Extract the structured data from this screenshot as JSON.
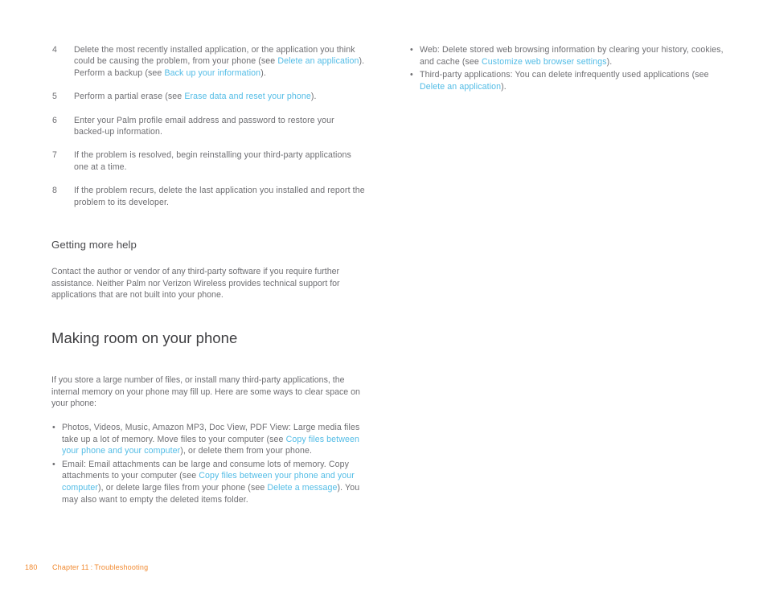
{
  "document": {
    "page_number": "180",
    "chapter_label": "Chapter 11",
    "chapter_separator": ":",
    "chapter_title": "Troubleshooting"
  },
  "colors": {
    "link": "#52bce6",
    "body_text": "#6e6e72",
    "heading": "#3f3f42",
    "footer": "#f1892f",
    "background": "#ffffff"
  },
  "left_column": {
    "steps": [
      {
        "number": "4",
        "parts": [
          {
            "type": "text",
            "text": "Delete the most recently installed application, or the application you think could be causing the problem, from your phone (see "
          },
          {
            "type": "link",
            "text": "Delete an application"
          },
          {
            "type": "text",
            "text": "). Perform a backup (see "
          },
          {
            "type": "link",
            "text": "Back up your information"
          },
          {
            "type": "text",
            "text": ")."
          }
        ]
      },
      {
        "number": "5",
        "parts": [
          {
            "type": "text",
            "text": "Perform a partial erase (see "
          },
          {
            "type": "link",
            "text": "Erase data and reset your phone"
          },
          {
            "type": "text",
            "text": ")."
          }
        ]
      },
      {
        "number": "6",
        "parts": [
          {
            "type": "text",
            "text": "Enter your Palm profile email address and password to restore your backed-up information."
          }
        ]
      },
      {
        "number": "7",
        "parts": [
          {
            "type": "text",
            "text": "If the problem is resolved, begin reinstalling your third-party applications one at a time."
          }
        ]
      },
      {
        "number": "8",
        "parts": [
          {
            "type": "text",
            "text": "If the problem recurs, delete the last application you installed and report the problem to its developer."
          }
        ]
      }
    ],
    "getting_more_help_heading": "Getting more help",
    "getting_more_help_paragraph": "Contact the author or vendor of any third-party software if you require further assistance. Neither Palm nor Verizon Wireless provides technical support for applications that are not built into your phone.",
    "making_room_heading": "Making room on your phone",
    "making_room_paragraph": "If you store a large number of files, or install many third-party applications, the internal memory on your phone may fill up. Here are some ways to clear space on your phone:",
    "bullets": [
      {
        "bullet_glyph": "•",
        "parts": [
          {
            "type": "text",
            "text": "Photos, Videos, Music, Amazon MP3, Doc View, PDF View: Large media files take up a lot of memory. Move files to your computer (see "
          },
          {
            "type": "link",
            "text": "Copy files between your phone and your computer"
          },
          {
            "type": "text",
            "text": "), or delete them from your phone."
          }
        ]
      },
      {
        "bullet_glyph": "•",
        "parts": [
          {
            "type": "text",
            "text": "Email: Email attachments can be large and consume lots of memory. Copy attachments to your computer (see "
          },
          {
            "type": "link",
            "text": "Copy files between your phone and your computer"
          },
          {
            "type": "text",
            "text": "), or delete large files from your phone (see "
          },
          {
            "type": "link",
            "text": "Delete a message"
          },
          {
            "type": "text",
            "text": "). You may also want to empty the deleted items folder."
          }
        ]
      }
    ]
  },
  "right_column": {
    "bullets": [
      {
        "bullet_glyph": "•",
        "parts": [
          {
            "type": "text",
            "text": "Web: Delete stored web browsing information by clearing your history, cookies, and cache (see "
          },
          {
            "type": "link",
            "text": "Customize web browser settings"
          },
          {
            "type": "text",
            "text": ")."
          }
        ]
      },
      {
        "bullet_glyph": "•",
        "parts": [
          {
            "type": "text",
            "text": "Third-party applications: You can delete infrequently used applications (see "
          },
          {
            "type": "link",
            "text": "Delete an application"
          },
          {
            "type": "text",
            "text": ")."
          }
        ]
      }
    ]
  }
}
